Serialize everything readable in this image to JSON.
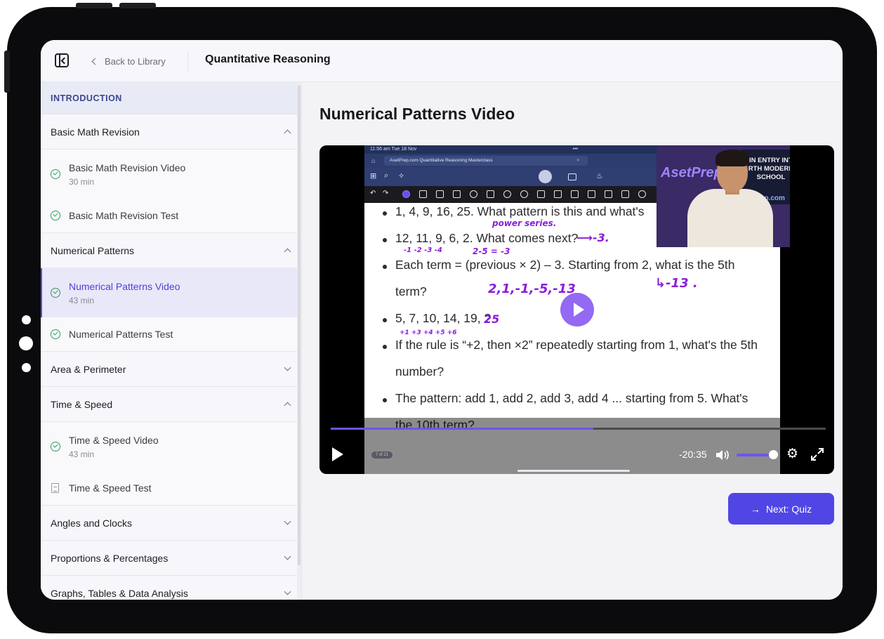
{
  "header": {
    "back_label": "Back to Library",
    "course_title": "Quantitative Reasoning"
  },
  "sidebar": {
    "intro_label": "INTRODUCTION",
    "sections": [
      {
        "title": "Basic Math Revision",
        "expanded": true,
        "lessons": [
          {
            "name": "Basic Math Revision Video",
            "duration": "30 min",
            "icon": "check-circle-icon"
          },
          {
            "name": "Basic Math Revision Test",
            "icon": "check-circle-icon"
          }
        ]
      },
      {
        "title": "Numerical Patterns",
        "expanded": true,
        "lessons": [
          {
            "name": "Numerical Patterns Video",
            "duration": "43 min",
            "icon": "check-circle-icon",
            "active": true
          },
          {
            "name": "Numerical Patterns Test",
            "icon": "check-circle-icon"
          }
        ]
      },
      {
        "title": "Area & Perimeter",
        "expanded": false
      },
      {
        "title": "Time & Speed",
        "expanded": true,
        "lessons": [
          {
            "name": "Time & Speed Video",
            "duration": "43 min",
            "icon": "check-circle-icon"
          },
          {
            "name": "Time & Speed Test",
            "icon": "document-icon"
          }
        ]
      },
      {
        "title": "Angles and Clocks",
        "expanded": false
      },
      {
        "title": "Proportions & Percentages",
        "expanded": false
      },
      {
        "title": "Graphs, Tables & Data Analysis",
        "expanded": false
      }
    ]
  },
  "main": {
    "heading": "Numerical Patterns Video",
    "next_button": "Next: Quiz"
  },
  "video": {
    "time_remaining": "-20:35",
    "progress": 0.53,
    "volume": 0.95,
    "status_time": "11:56 am  Tue 18 Nov",
    "browser_tab": "AsetPrep.com Quantitative Reasoning Masterclass",
    "page_indicator": "7 of 21",
    "slide_lines": [
      "1, 4, 9, 16, 25. What pattern is this and what's",
      "12, 11, 9, 6, 2. What comes next?",
      "Each term = (previous × 2) – 3. Starting from 2, what is the 5th",
      "term?",
      "5, 7, 10, 14, 19, ?",
      "If the rule is “+2, then ×2” repeatedly starting from 1, what's the 5th",
      "number?",
      "The pattern: add 1, add 2, add 3, add 4 ... starting from 5. What's",
      "the 10th term?"
    ],
    "annotations": {
      "power_series": "power series.",
      "arrow_minus3": "⟶-3.",
      "diffs1": "-1 -2 -3 -4",
      "calc": "2-5 = -3",
      "sequence": "2,1,-1,-5,-13",
      "result": "↳-13 .",
      "answer25": "25",
      "diffs2": "+1 +3 +4 +5 +6"
    },
    "webcam": {
      "logo_text": "AsetPrep",
      "banner_line1": "AIN ENTRY INTO",
      "banner_line2": "RTH MODERN",
      "banner_line3": "SCHOOL",
      "banner_bottom": "tPrep.com"
    }
  },
  "colors": {
    "accent": "#5046e5",
    "progress": "#6d55f0",
    "check": "#2e9c5c",
    "ink": "#8a1ed8"
  }
}
